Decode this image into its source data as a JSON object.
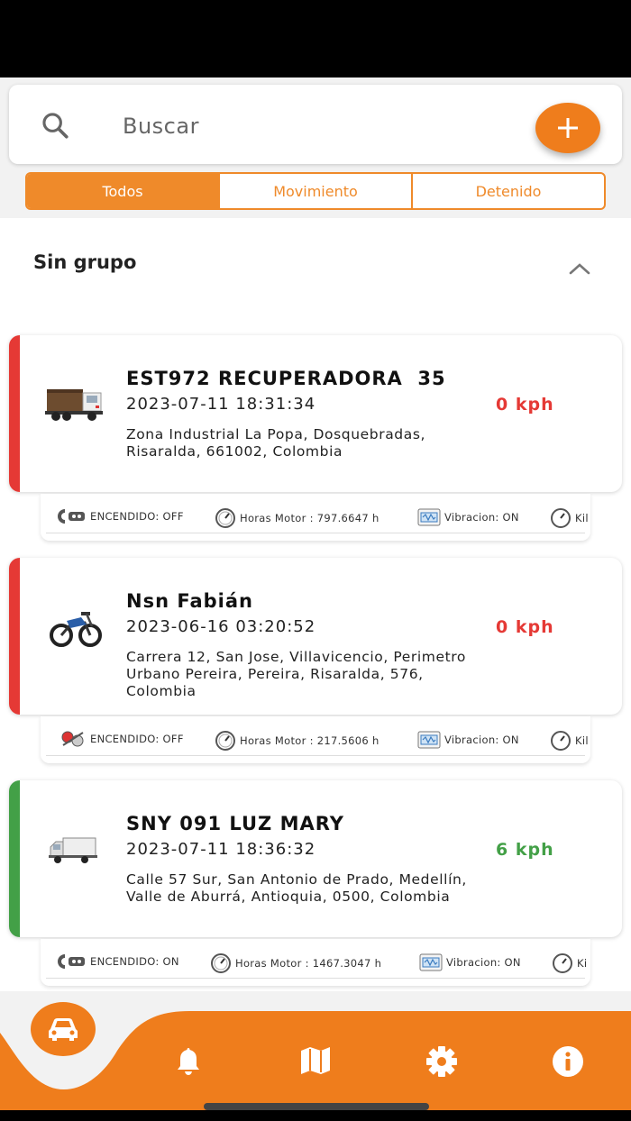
{
  "search": {
    "placeholder": "Buscar"
  },
  "filters": [
    {
      "label": "Todos",
      "active": true
    },
    {
      "label": "Movimiento",
      "active": false
    },
    {
      "label": "Detenido",
      "active": false
    }
  ],
  "group": {
    "title": "Sin grupo"
  },
  "vehicles": [
    {
      "name": "EST972 RECUPERADORA  35",
      "datetime": "2023-07-11 18:31:34",
      "speed": "0 kph",
      "address": "Zona Industrial La Popa, Dosquebradas, Risaralda, 661002, Colombia",
      "status_color": "#e53935",
      "icon": "truck-icon",
      "stats": {
        "ignition": "ENCENDIDO: OFF",
        "engine_hours": "Horas Motor : 797.6647 h",
        "vibration": "Vibracion: ON",
        "km": "Kil"
      }
    },
    {
      "name": "Nsn Fabián",
      "datetime": "2023-06-16 03:20:52",
      "speed": "0 kph",
      "address": "Carrera 12, San Jose, Villavicencio, Perimetro Urbano Pereira, Pereira, Risaralda, 576, Colombia",
      "status_color": "#e53935",
      "icon": "motorcycle-icon",
      "stats": {
        "ignition": "ENCENDIDO: OFF",
        "engine_hours": "Horas Motor : 217.5606 h",
        "vibration": "Vibracion: ON",
        "km": "Kil"
      }
    },
    {
      "name": "SNY 091 LUZ MARY",
      "datetime": "2023-07-11 18:36:32",
      "speed": "6 kph",
      "address": "Calle 57 Sur, San Antonio de Prado, Medellín, Valle de Aburrá, Antioquia, 0500, Colombia",
      "status_color": "#43a047",
      "icon": "van-icon",
      "stats": {
        "ignition": "ENCENDIDO: ON",
        "engine_hours": "Horas Motor : 1467.3047 h",
        "vibration": "Vibracion: ON",
        "km": "Ki"
      }
    }
  ],
  "nav": [
    "car-icon",
    "bell-icon",
    "map-icon",
    "gear-icon",
    "info-icon"
  ],
  "colors": {
    "accent": "#ef7d1c",
    "stopped": "#e53935",
    "moving": "#43a047"
  }
}
